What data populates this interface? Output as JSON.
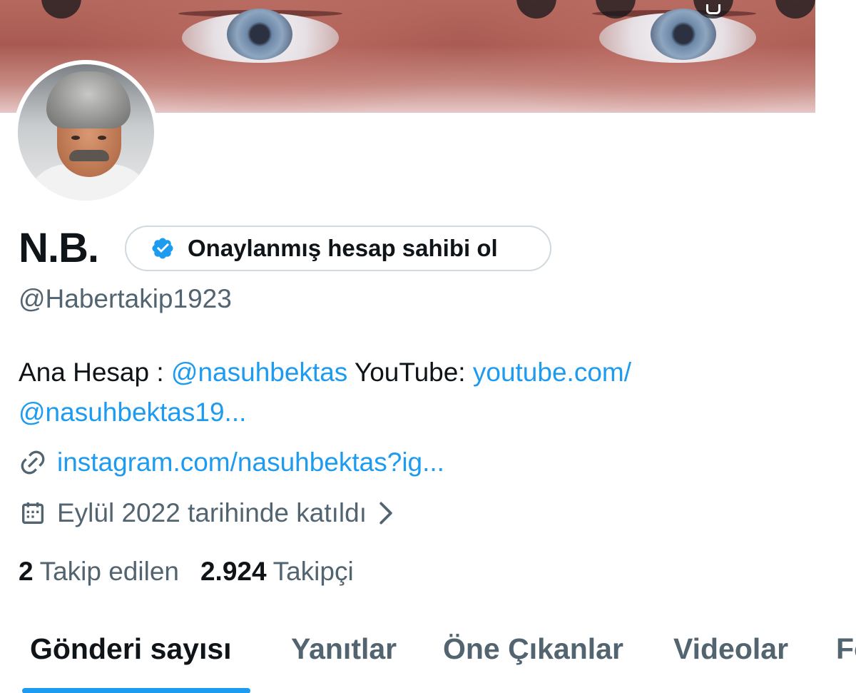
{
  "profile": {
    "name": "N.B.",
    "verify_label": "Onaylanmış hesap sahibi ol",
    "handle": "@Habertakip1923",
    "bio": {
      "prefix": "Ana Hesap : ",
      "mention": "@nasuhbektas",
      "middle": " YouTube: ",
      "youtube_link": "youtube.com/",
      "youtube_cont": "@nasuhbektas19..."
    },
    "website": "instagram.com/nasuhbektas?ig...",
    "joined": "Eylül 2022 tarihinde katıldı",
    "following_count": "2",
    "following_label": "Takip edilen",
    "followers_count": "2.924",
    "followers_label": "Takipçi"
  },
  "tabs": [
    {
      "label": "Gönderi sayısı",
      "active": true
    },
    {
      "label": "Yanıtlar"
    },
    {
      "label": "Öne Çıkanlar"
    },
    {
      "label": "Videolar"
    },
    {
      "label": "Fo"
    }
  ],
  "colors": {
    "accent": "#1d9bf0",
    "text_primary": "#0f1419",
    "text_secondary": "#536471",
    "border": "#cfd9de"
  },
  "icons": {
    "verified": "verified-badge-icon",
    "link": "link-icon",
    "calendar": "calendar-icon",
    "chevron": "chevron-right-icon"
  }
}
